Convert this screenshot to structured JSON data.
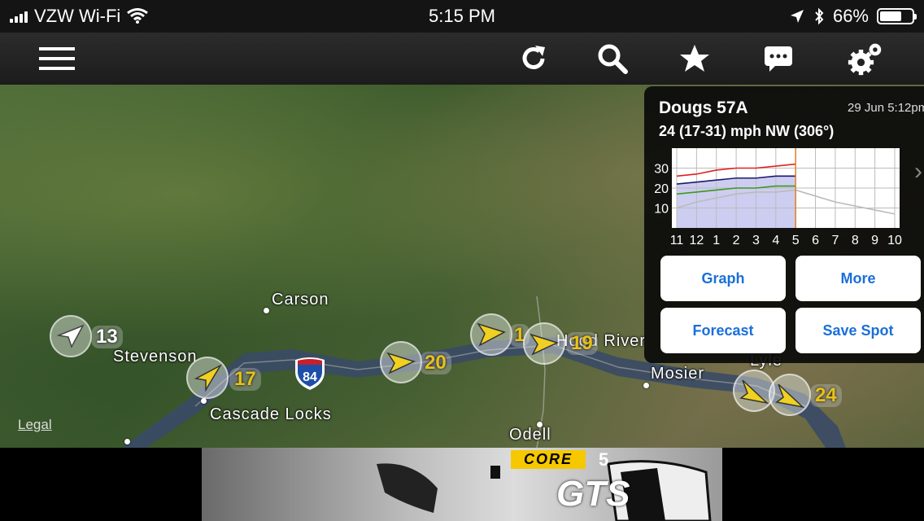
{
  "status_bar": {
    "carrier": "VZW Wi-Fi",
    "time": "5:15 PM",
    "battery": "66%",
    "battery_level": 0.66
  },
  "toolbar": {
    "icons": [
      "menu-icon",
      "refresh-icon",
      "search-icon",
      "star-icon",
      "chat-icon",
      "settings-icon"
    ]
  },
  "map": {
    "towns": [
      "Carson",
      "Stevenson",
      "Cascade Locks",
      "Odell",
      "Mosier",
      "Lyle",
      "Hood River"
    ],
    "highway_shield": "84",
    "legal": "Legal"
  },
  "stations": [
    {
      "speed": "13",
      "color": "gray"
    },
    {
      "speed": "17",
      "color": "yellow"
    },
    {
      "speed": "20",
      "color": "yellow"
    },
    {
      "speed": "1",
      "color": "yellow"
    },
    {
      "speed": "19",
      "color": "yellow"
    },
    {
      "speed": "24",
      "color": "yellow"
    }
  ],
  "popup": {
    "name": "Dougs 57A",
    "date": "29 Jun 5:12pm",
    "wind": "24 (17-31) mph NW (306°)",
    "buttons": {
      "graph": "Graph",
      "more": "More",
      "forecast": "Forecast",
      "save": "Save Spot"
    }
  },
  "chart_data": {
    "type": "line",
    "x": [
      "11",
      "12",
      "1",
      "2",
      "3",
      "4",
      "5",
      "6",
      "7",
      "8",
      "9",
      "10"
    ],
    "y_ticks": [
      "10",
      "20",
      "30"
    ],
    "ylim": [
      0,
      40
    ],
    "series": [
      {
        "name": "",
        "color": "#e02020",
        "values": [
          26,
          27,
          29,
          30,
          30,
          31,
          32
        ]
      },
      {
        "name": "",
        "color": "#1a1a6a",
        "values": [
          22,
          23,
          24,
          25,
          25,
          26,
          26
        ]
      },
      {
        "name": "",
        "color": "#3a9a1a",
        "values": [
          17,
          18,
          19,
          20,
          20,
          21,
          21
        ]
      },
      {
        "name": "",
        "color": "#bbbbbb",
        "values": [
          10,
          13,
          15,
          17,
          18,
          18,
          19,
          16,
          13,
          11,
          9,
          7
        ]
      }
    ],
    "now_index": 6
  },
  "ad": {
    "brand": "CORE",
    "product": "GTS",
    "version": "5"
  },
  "colors": {
    "accent": "#1a6fd8",
    "wind_yellow": "#e8c218"
  }
}
